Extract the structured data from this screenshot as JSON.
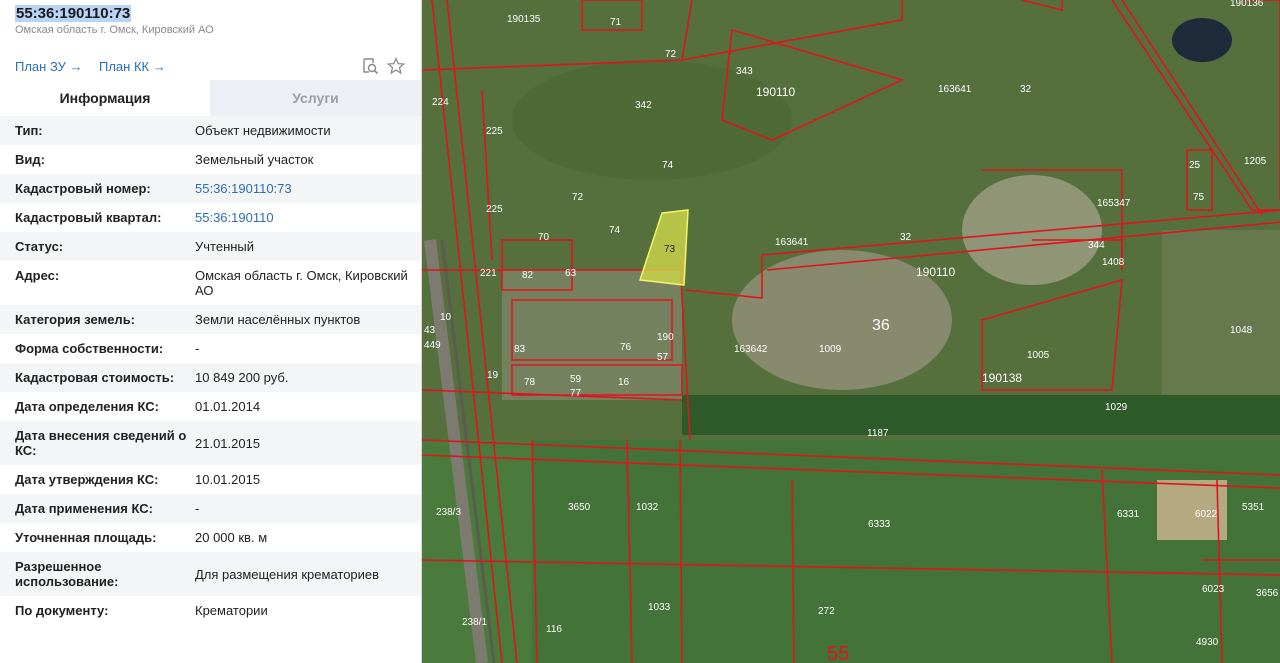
{
  "object": {
    "cadastral_title": "55:36:190110:73",
    "subtitle": "Омская область г. Омск, Кировский АО"
  },
  "links": {
    "plan_zu": "План ЗУ →",
    "plan_kk": "План КК →"
  },
  "tabs": [
    {
      "label": "Информация"
    },
    {
      "label": "Услуги"
    }
  ],
  "rows": [
    {
      "label": "Тип:",
      "value": "Объект недвижимости"
    },
    {
      "label": "Вид:",
      "value": "Земельный участок"
    },
    {
      "label": "Кадастровый номер:",
      "value": "55:36:190110:73"
    },
    {
      "label": "Кадастровый квартал:",
      "value": "55:36:190110"
    },
    {
      "label": "Статус:",
      "value": "Учтенный"
    },
    {
      "label": "Адрес:",
      "value": "Омская область г. Омск, Кировский АО"
    },
    {
      "label": "Категория земель:",
      "value": "Земли населённых пунктов"
    },
    {
      "label": "Форма собственности:",
      "value": "-"
    },
    {
      "label": "Кадастровая стоимость:",
      "value": "10 849 200 руб."
    },
    {
      "label": "Дата определения КС:",
      "value": "01.01.2014"
    },
    {
      "label": "Дата внесения сведений о КС:",
      "value": "21.01.2015"
    },
    {
      "label": "Дата утверждения КС:",
      "value": "10.01.2015"
    },
    {
      "label": "Дата применения КС:",
      "value": "-"
    },
    {
      "label": "Уточненная площадь:",
      "value": "20 000 кв. м"
    },
    {
      "label": "Разрешенное использование:",
      "value": "Для размещения крематориев"
    },
    {
      "label": "По документу:",
      "value": "Крематории"
    }
  ],
  "map": {
    "highlight_color": "#d6e04a",
    "boundary_color": "#e0141e",
    "labels": {
      "l190135": "190135",
      "l71": "71",
      "l72a": "72",
      "l343": "343",
      "l342": "342",
      "l190110a": "190110",
      "l163641a": "163641",
      "l32a": "32",
      "l224": "224",
      "l225a": "225",
      "l225b": "225",
      "l74a": "74",
      "l72b": "72",
      "l74b": "74",
      "l73": "73",
      "l70": "70",
      "l82": "82",
      "l63": "63",
      "l221": "221",
      "l163641b": "163641",
      "l32b": "32",
      "l190110b": "190110",
      "l190": "190",
      "l76": "76",
      "l57": "57",
      "l83": "83",
      "l59": "59",
      "l77": "77",
      "l78": "78",
      "l16": "16",
      "l19": "19",
      "l43": "43",
      "l449": "449",
      "l10": "10",
      "l163642": "163642",
      "l1009": "1009",
      "l36": "36",
      "l1005": "1005",
      "l190138": "190138",
      "l1029": "1029",
      "l1187": "1187",
      "l1048": "1048",
      "l165347": "165347",
      "l344": "344",
      "l1408": "1408",
      "l25": "25",
      "l75": "75",
      "l1205": "1205",
      "l238_3": "238/3",
      "l3650": "3650",
      "l1032": "1032",
      "l6333": "6333",
      "l6331": "6331",
      "l6022": "6022",
      "l5351": "5351",
      "l1033": "1033",
      "l272": "272",
      "l6023": "6023",
      "l3656": "3656",
      "l4930": "4930",
      "l238_1": "238/1",
      "l116": "116",
      "l55": "55",
      "l190136": "190136"
    }
  }
}
